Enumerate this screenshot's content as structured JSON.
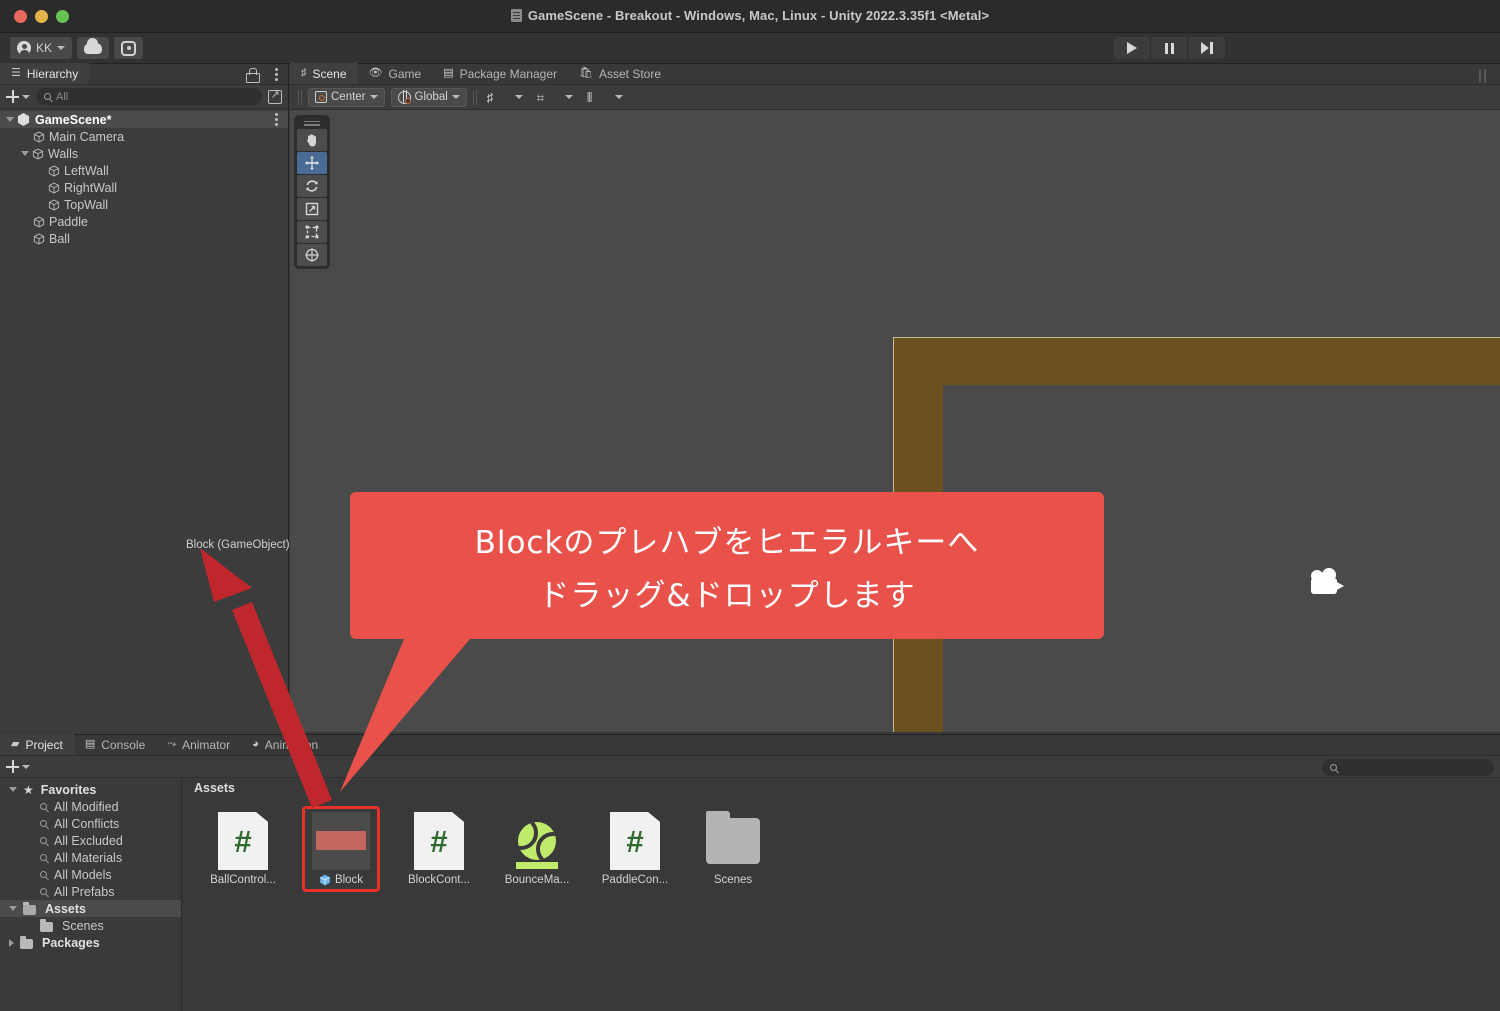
{
  "window": {
    "title": "GameScene - Breakout - Windows, Mac, Linux - Unity 2022.3.35f1 <Metal>",
    "doc_icon": "document-icon",
    "traffic_lights": [
      "close",
      "minimize",
      "zoom"
    ]
  },
  "top_toolbar": {
    "account_label": "KK",
    "account_icon": "avatar-icon",
    "cloud_icon": "cloud-icon",
    "settings_icon": "gear-icon",
    "play_icon": "play-icon",
    "pause_icon": "pause-icon",
    "step_icon": "step-icon"
  },
  "hierarchy": {
    "tab_label": "Hierarchy",
    "tab_icon": "hierarchy-icon",
    "lock_icon": "lock-icon",
    "menu_icon": "kebab-menu-icon",
    "add_label": "+",
    "search_placeholder": "All",
    "search_value": "",
    "search_icon": "search-icon",
    "expand_icon": "expand-icon",
    "items": [
      {
        "label": "GameScene*",
        "depth": 0,
        "icon": "unity-scene-icon",
        "expanded": true,
        "selected": true
      },
      {
        "label": "Main Camera",
        "depth": 1,
        "icon": "gameobject-cube-icon",
        "expanded": null,
        "selected": false
      },
      {
        "label": "Walls",
        "depth": 1,
        "icon": "gameobject-cube-icon",
        "expanded": true,
        "selected": false
      },
      {
        "label": "LeftWall",
        "depth": 2,
        "icon": "gameobject-cube-icon",
        "expanded": null,
        "selected": false
      },
      {
        "label": "RightWall",
        "depth": 2,
        "icon": "gameobject-cube-icon",
        "expanded": null,
        "selected": false
      },
      {
        "label": "TopWall",
        "depth": 2,
        "icon": "gameobject-cube-icon",
        "expanded": null,
        "selected": false
      },
      {
        "label": "Paddle",
        "depth": 1,
        "icon": "gameobject-cube-icon",
        "expanded": null,
        "selected": false
      },
      {
        "label": "Ball",
        "depth": 1,
        "icon": "gameobject-cube-icon",
        "expanded": null,
        "selected": false
      }
    ]
  },
  "scene_panel": {
    "tabs": [
      {
        "label": "Scene",
        "icon": "scene-grid-icon",
        "active": true
      },
      {
        "label": "Game",
        "icon": "gamepad-icon",
        "active": false
      },
      {
        "label": "Package Manager",
        "icon": "package-icon",
        "active": false
      },
      {
        "label": "Asset Store",
        "icon": "store-bag-icon",
        "active": false
      }
    ],
    "toolbar": {
      "pivot_label": "Center",
      "pivot_icon": "pivot-icon",
      "space_label": "Global",
      "space_icon": "globe-icon",
      "grid_icon": "grid-axis-icon",
      "snap_icon": "snap-increment-icon",
      "layout_icon": "grid-snap-icon",
      "dropdown_icon": "chevron-down-icon"
    },
    "tools": [
      {
        "name": "hand-tool",
        "glyph": "✋",
        "active": false
      },
      {
        "name": "move-tool",
        "glyph": "✥",
        "active": true
      },
      {
        "name": "rotate-tool",
        "glyph": "↻",
        "active": false
      },
      {
        "name": "scale-tool",
        "glyph": "⤢",
        "active": false
      },
      {
        "name": "rect-tool",
        "glyph": "⬚",
        "active": false
      },
      {
        "name": "transform-tool",
        "glyph": "✧",
        "active": false
      }
    ],
    "objects": {
      "wall_color": "#6b511f",
      "wall_outline": "#c9b88a",
      "background": "#4a4a4a",
      "ball_color": "#ffffff",
      "paddle_color": "#ffffff",
      "camera_gizmo": "camera-gizmo-icon"
    }
  },
  "annotation": {
    "callout_color": "#e8524a",
    "line1": "Blockのプレハブをヒエラルキーへ",
    "line2": "ドラッグ&ドロップします",
    "arrow_color": "#c0272d",
    "drag_ghost_label": "Block (GameObject)"
  },
  "project_panel": {
    "tabs": [
      {
        "label": "Project",
        "icon": "folder-icon",
        "active": true
      },
      {
        "label": "Console",
        "icon": "console-icon",
        "active": false
      },
      {
        "label": "Animator",
        "icon": "animator-icon",
        "active": false
      },
      {
        "label": "Animation",
        "icon": "animation-clock-icon",
        "active": false
      }
    ],
    "add_label": "+",
    "search_value": "",
    "search_placeholder": "",
    "search_icon": "search-icon",
    "tree": [
      {
        "label": "Favorites",
        "depth": 0,
        "icon": "star-icon",
        "expanded": true,
        "bold": true,
        "selected": false
      },
      {
        "label": "All Modified",
        "depth": 1,
        "icon": "search-icon",
        "expanded": null,
        "bold": false,
        "selected": false
      },
      {
        "label": "All Conflicts",
        "depth": 1,
        "icon": "search-icon",
        "expanded": null,
        "bold": false,
        "selected": false
      },
      {
        "label": "All Excluded",
        "depth": 1,
        "icon": "search-icon",
        "expanded": null,
        "bold": false,
        "selected": false
      },
      {
        "label": "All Materials",
        "depth": 1,
        "icon": "search-icon",
        "expanded": null,
        "bold": false,
        "selected": false
      },
      {
        "label": "All Models",
        "depth": 1,
        "icon": "search-icon",
        "expanded": null,
        "bold": false,
        "selected": false
      },
      {
        "label": "All Prefabs",
        "depth": 1,
        "icon": "search-icon",
        "expanded": null,
        "bold": false,
        "selected": false
      },
      {
        "label": "Assets",
        "depth": 0,
        "icon": "folder-open-icon",
        "expanded": true,
        "bold": true,
        "selected": true
      },
      {
        "label": "Scenes",
        "depth": 1,
        "icon": "folder-icon",
        "expanded": null,
        "bold": false,
        "selected": false
      },
      {
        "label": "Packages",
        "depth": 0,
        "icon": "folder-icon",
        "expanded": false,
        "bold": true,
        "selected": false
      }
    ],
    "breadcrumb": "Assets",
    "assets": [
      {
        "label": "BallControl...",
        "type": "script",
        "icon": "csharp-script-icon",
        "selected": false
      },
      {
        "label": "Block",
        "type": "prefab",
        "icon": "prefab-cube-icon",
        "selected": true
      },
      {
        "label": "BlockCont...",
        "type": "script",
        "icon": "csharp-script-icon",
        "selected": false
      },
      {
        "label": "BounceMa...",
        "type": "material",
        "icon": "material-sphere-icon",
        "selected": false
      },
      {
        "label": "PaddleCon...",
        "type": "script",
        "icon": "csharp-script-icon",
        "selected": false
      },
      {
        "label": "Scenes",
        "type": "folder",
        "icon": "folder-icon",
        "selected": false
      }
    ]
  }
}
